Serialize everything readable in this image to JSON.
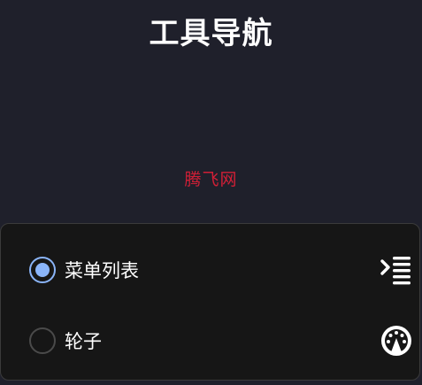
{
  "header": {
    "title": "工具导航"
  },
  "brand": {
    "link_text": "腾飞网",
    "color": "#d11f36"
  },
  "options": [
    {
      "label": "菜单列表",
      "selected": true,
      "icon": "menu-list-icon"
    },
    {
      "label": "轮子",
      "selected": false,
      "icon": "wheel-icon"
    }
  ],
  "colors": {
    "background": "#1f202b",
    "panel": "#161616",
    "accent": "#8ab4f8"
  }
}
